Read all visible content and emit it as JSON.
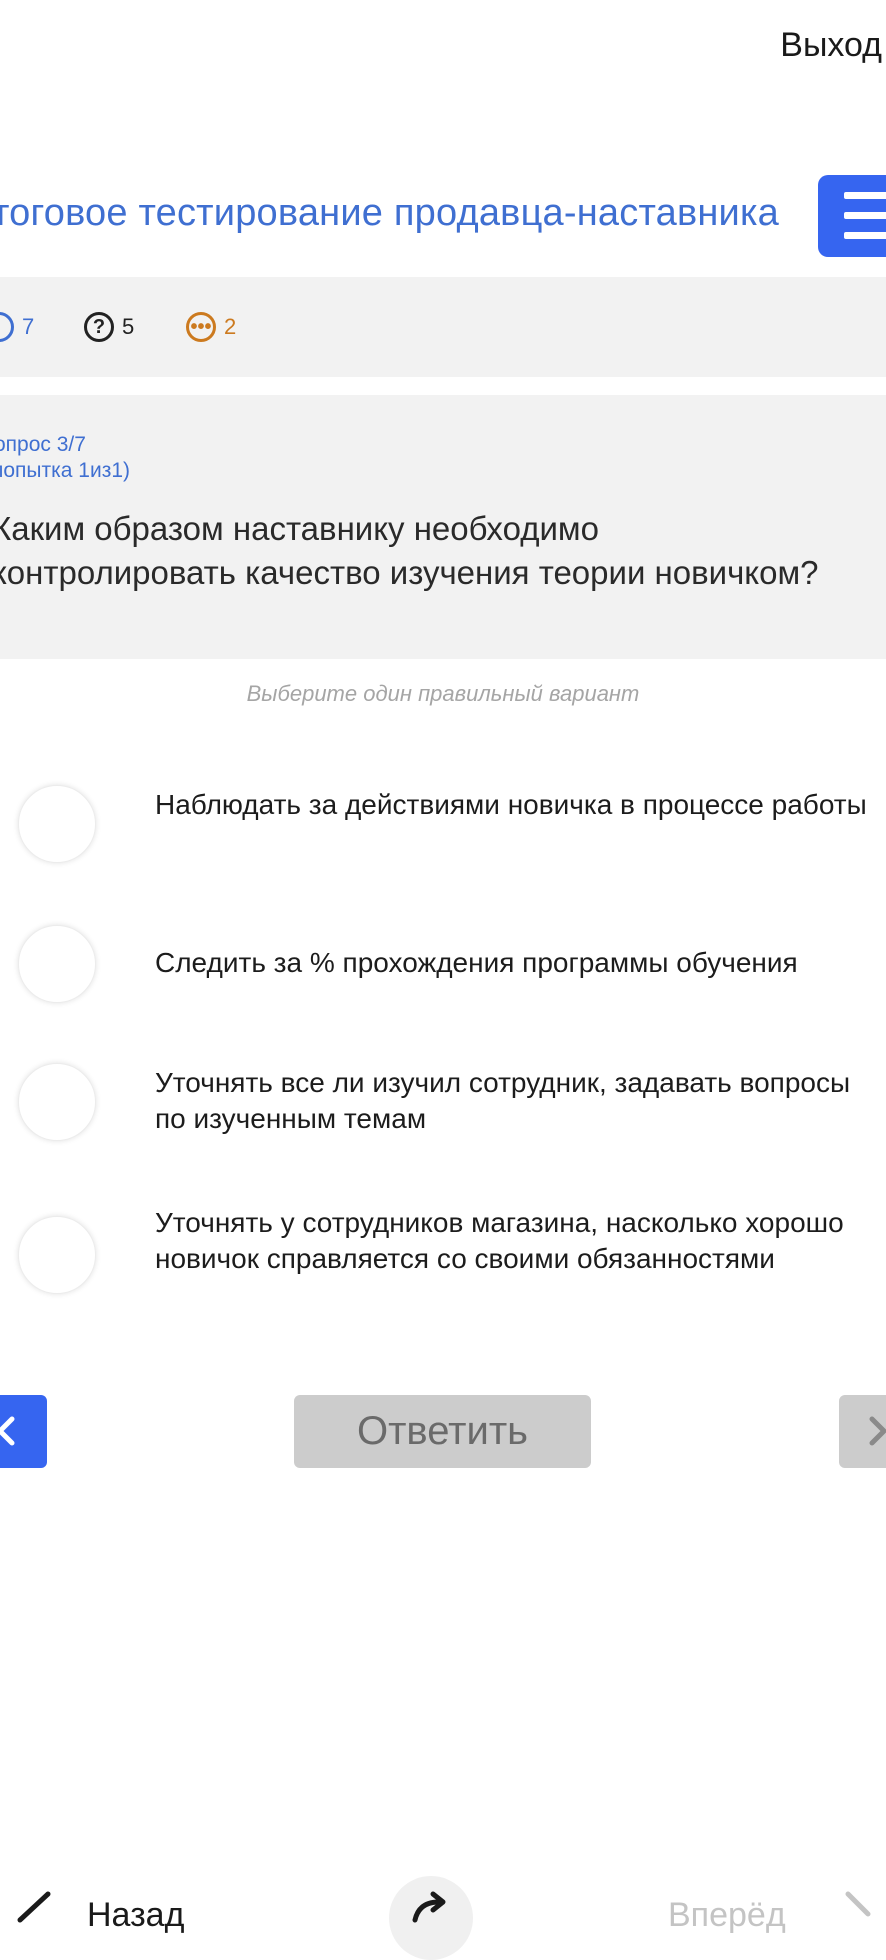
{
  "header": {
    "exit_label": "Выход"
  },
  "test": {
    "title": "тоговое тестирование продавца-наставника"
  },
  "stats": {
    "correct": "7",
    "unanswered": "5",
    "skipped": "2",
    "colors": {
      "correct": "#3f6fd1",
      "unanswered": "#222222",
      "skipped": "#cc7a1f"
    }
  },
  "question": {
    "number": "опрос 3/7",
    "attempt": "попытка 1из1)",
    "text": "Каким образом наставнику необходимо контролировать качество изучения теории новичком?",
    "hint": "Выберите один правильный вариант"
  },
  "options": [
    {
      "label": "Наблюдать за действиями новичка в процессе работы"
    },
    {
      "label": "Следить за % прохождения программы обучения"
    },
    {
      "label": "Уточнять все ли изучил сотрудник, задавать вопросы по изученным темам"
    },
    {
      "label": "Уточнять у сотрудников магазина, насколько хорошо новичок справляется со своими обязанностями"
    }
  ],
  "actions": {
    "answer_label": "Ответить"
  },
  "bottom_nav": {
    "back_label": "Назад",
    "forward_label": "Вперёд"
  },
  "colors": {
    "accent": "#3665f0",
    "link": "#3f6fd1",
    "panel": "#f2f2f2",
    "disabled": "#cccccc"
  }
}
